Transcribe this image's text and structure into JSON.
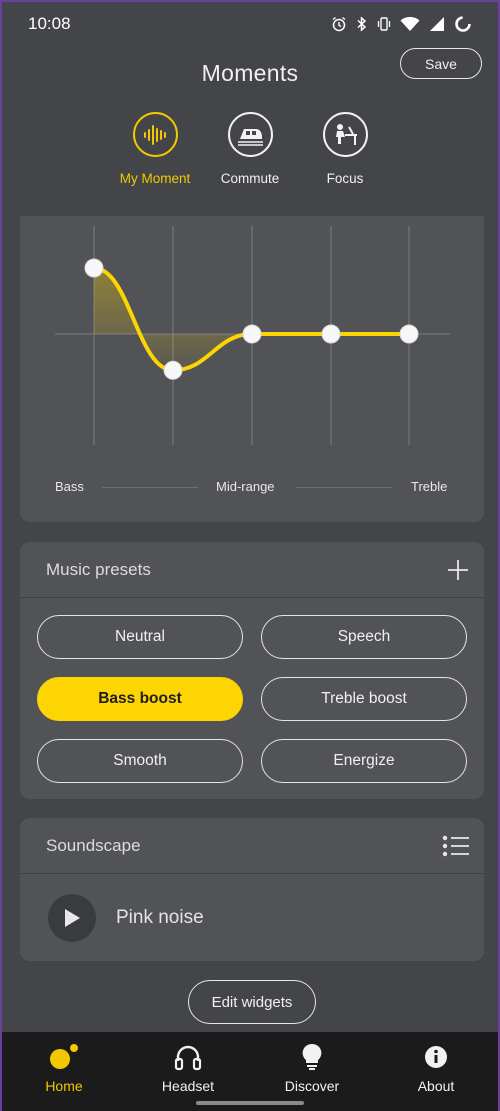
{
  "status_bar": {
    "time": "10:08",
    "icons": [
      "alarm-icon",
      "bluetooth-icon",
      "vibrate-icon",
      "wifi-icon",
      "signal-icon",
      "battery-icon"
    ]
  },
  "header": {
    "title": "Moments",
    "save_label": "Save"
  },
  "moments": [
    {
      "label": "My Moment",
      "icon": "soundwave-icon",
      "active": true
    },
    {
      "label": "Commute",
      "icon": "train-icon",
      "active": false
    },
    {
      "label": "Focus",
      "icon": "desk-person-icon",
      "active": false
    }
  ],
  "equalizer": {
    "band_labels": {
      "low": "Bass",
      "mid": "Mid-range",
      "high": "Treble"
    },
    "band_levels": [
      2,
      -1.1,
      0,
      0,
      0
    ],
    "accent_color": "#fcd502"
  },
  "presets": {
    "title": "Music presets",
    "add_icon": "plus-icon",
    "items": [
      "Neutral",
      "Speech",
      "Bass boost",
      "Treble boost",
      "Smooth",
      "Energize"
    ],
    "selected": "Bass boost"
  },
  "soundscape": {
    "title": "Soundscape",
    "list_icon": "list-icon",
    "current": "Pink noise",
    "play_icon": "play-icon"
  },
  "edit_widgets_label": "Edit widgets",
  "nav": [
    {
      "label": "Home",
      "icon": "home-dots-icon",
      "active": true
    },
    {
      "label": "Headset",
      "icon": "headphones-icon",
      "active": false
    },
    {
      "label": "Discover",
      "icon": "lightbulb-icon",
      "active": false
    },
    {
      "label": "About",
      "icon": "info-icon",
      "active": false
    }
  ]
}
